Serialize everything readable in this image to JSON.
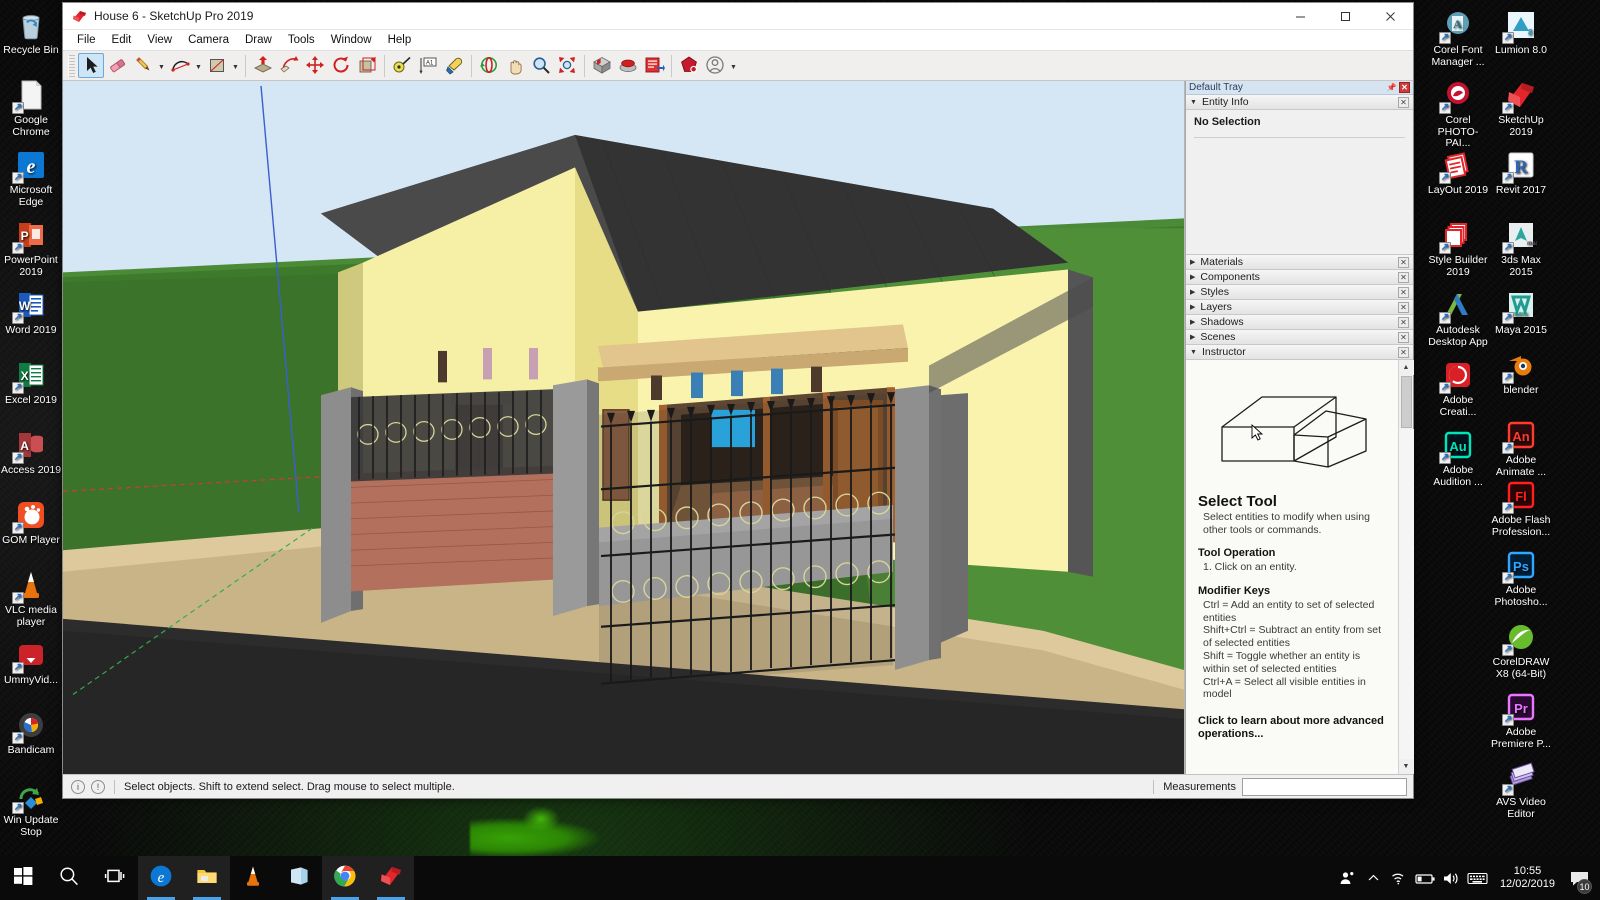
{
  "window": {
    "title": "House 6 - SketchUp Pro 2019",
    "app_icon": "sketchup-logo-icon",
    "controls": {
      "minimize": "—",
      "maximize": "☐",
      "close": "✕"
    }
  },
  "menu": [
    "File",
    "Edit",
    "View",
    "Camera",
    "Draw",
    "Tools",
    "Window",
    "Help"
  ],
  "toolbar": {
    "groups": [
      {
        "items": [
          {
            "name": "select-tool",
            "glyph": "arrow",
            "active": true
          },
          {
            "name": "eraser-tool",
            "glyph": "eraser",
            "active": false
          },
          {
            "name": "line-tool",
            "glyph": "pencil",
            "active": false,
            "dropdown": true
          },
          {
            "name": "arc-tool",
            "glyph": "arc",
            "active": false,
            "dropdown": true
          },
          {
            "name": "rectangle-tool",
            "glyph": "rectangle",
            "active": false,
            "dropdown": true
          }
        ]
      },
      {
        "items": [
          {
            "name": "push-pull-tool",
            "glyph": "pushpull",
            "active": false
          },
          {
            "name": "follow-me-tool",
            "glyph": "followme",
            "active": false
          },
          {
            "name": "move-tool",
            "glyph": "move",
            "active": false
          },
          {
            "name": "rotate-tool",
            "glyph": "rotate",
            "active": false
          },
          {
            "name": "scale-tool",
            "glyph": "scale",
            "active": false
          }
        ]
      },
      {
        "items": [
          {
            "name": "tape-measure-tool",
            "glyph": "tape",
            "active": false
          },
          {
            "name": "dimension-tool",
            "glyph": "dimension",
            "active": false
          },
          {
            "name": "paint-bucket-tool",
            "glyph": "paint",
            "active": false
          }
        ]
      },
      {
        "items": [
          {
            "name": "orbit-tool",
            "glyph": "orbit",
            "active": false
          },
          {
            "name": "pan-tool",
            "glyph": "pan",
            "active": false
          },
          {
            "name": "zoom-tool",
            "glyph": "zoom",
            "active": false
          },
          {
            "name": "zoom-extents-tool",
            "glyph": "zoomextents",
            "active": false
          }
        ]
      },
      {
        "items": [
          {
            "name": "warehouse-get-models",
            "glyph": "wh1",
            "active": false
          },
          {
            "name": "warehouse-share-model",
            "glyph": "wh2",
            "active": false
          },
          {
            "name": "warehouse-extension",
            "glyph": "wh3",
            "active": false
          }
        ]
      },
      {
        "items": [
          {
            "name": "extension-warehouse-button",
            "glyph": "ruby",
            "active": false
          },
          {
            "name": "account-button",
            "glyph": "account",
            "active": false,
            "dropdown": true
          }
        ]
      }
    ]
  },
  "tray": {
    "title": "Default Tray",
    "entity_info": {
      "header": "Entity Info",
      "selection": "No Selection"
    },
    "panels": [
      {
        "label": "Materials",
        "expanded": false
      },
      {
        "label": "Components",
        "expanded": false
      },
      {
        "label": "Styles",
        "expanded": false
      },
      {
        "label": "Layers",
        "expanded": false
      },
      {
        "label": "Shadows",
        "expanded": false
      },
      {
        "label": "Scenes",
        "expanded": false
      },
      {
        "label": "Instructor",
        "expanded": true
      }
    ],
    "instructor": {
      "tool_title": "Select Tool",
      "tool_desc": "Select entities to modify when using other tools or commands.",
      "operation_heading": "Tool Operation",
      "operation_step": "1. Click on an entity.",
      "modifier_heading": "Modifier Keys",
      "modifiers": [
        "Ctrl = Add an entity to set of selected entities",
        "Shift+Ctrl = Subtract an entity from set of selected entities",
        "Shift = Toggle whether an entity is within set of selected entities",
        "Ctrl+A = Select all visible entities in model"
      ],
      "learn_more": "Click to learn about more advanced operations..."
    }
  },
  "statusbar": {
    "message": "Select objects. Shift to extend select. Drag mouse to select multiple.",
    "measurements_label": "Measurements",
    "measurements_value": ""
  },
  "desktop": {
    "left_icons": [
      {
        "label": "Recycle Bin",
        "glyph": "recycle-bin-icon",
        "color": "#6ea8c8",
        "shortcut": false
      },
      {
        "label": "Google Chrome",
        "glyph": "document-icon",
        "color": "#e9e9e9",
        "shortcut": true
      },
      {
        "label": "Microsoft Edge",
        "glyph": "edge-icon",
        "color": "#0c78d4",
        "shortcut": true
      },
      {
        "label": "PowerPoint 2019",
        "glyph": "powerpoint-icon",
        "color": "#c43e1c",
        "shortcut": true
      },
      {
        "label": "Word 2019",
        "glyph": "word-icon",
        "color": "#185abd",
        "shortcut": true
      },
      {
        "label": "Excel 2019",
        "glyph": "excel-icon",
        "color": "#107c41",
        "shortcut": true
      },
      {
        "label": "Access 2019",
        "glyph": "access-icon",
        "color": "#a4373a",
        "shortcut": true
      },
      {
        "label": "GOM Player",
        "glyph": "gom-player-icon",
        "color": "#f04e23",
        "shortcut": true
      },
      {
        "label": "VLC media player",
        "glyph": "vlc-icon",
        "color": "#e8720c",
        "shortcut": true
      },
      {
        "label": "UmmyVid...",
        "glyph": "ummy-downloader-icon",
        "color": "#cc2229",
        "shortcut": true
      },
      {
        "label": "Bandicam",
        "glyph": "bandicam-icon",
        "color": "#3d3d3d",
        "shortcut": true
      },
      {
        "label": "Win Update Stop",
        "glyph": "win-update-stop-icon",
        "color": "#3da648",
        "shortcut": true
      }
    ],
    "right_icons_col1": [
      {
        "label": "Corel Font Manager ...",
        "glyph": "corel-font-manager-icon",
        "color": "#5e9fb5",
        "shortcut": true
      },
      {
        "label": "Corel PHOTO-PAI...",
        "glyph": "corel-photopaint-icon",
        "color": "#c41230",
        "shortcut": true
      },
      {
        "label": "LayOut 2019",
        "glyph": "layout-icon",
        "color": "#e3262b",
        "shortcut": true
      },
      {
        "label": "Style Builder 2019",
        "glyph": "style-builder-icon",
        "color": "#e3262b",
        "shortcut": true
      },
      {
        "label": "Autodesk Desktop App",
        "glyph": "autodesk-icon",
        "color": "#3ba33b",
        "shortcut": true
      },
      {
        "label": "Adobe Creati...",
        "glyph": "adobe-cc-icon",
        "color": "#da1f26",
        "shortcut": true
      },
      {
        "label": "Adobe Audition ...",
        "glyph": "adobe-audition-icon",
        "color": "#00e4bb",
        "shortcut": true
      }
    ],
    "right_icons_col2": [
      {
        "label": "Lumion 8.0",
        "glyph": "lumion-icon",
        "color": "#dff0f6",
        "shortcut": true
      },
      {
        "label": "SketchUp 2019",
        "glyph": "sketchup-icon",
        "color": "#e3262b",
        "shortcut": true
      },
      {
        "label": "Revit 2017",
        "glyph": "revit-icon",
        "color": "#2f66b3",
        "shortcut": true
      },
      {
        "label": "3ds Max 2015",
        "glyph": "3dsmax-icon",
        "color": "#2ba79e",
        "shortcut": true
      },
      {
        "label": "Maya 2015",
        "glyph": "maya-icon",
        "color": "#2eb5a8",
        "shortcut": true
      },
      {
        "label": "blender",
        "glyph": "blender-icon",
        "color": "#e87d0d",
        "shortcut": true
      },
      {
        "label": "Adobe Animate ...",
        "glyph": "adobe-animate-icon",
        "color": "#ff3b30",
        "shortcut": true
      },
      {
        "label": "Adobe Flash Profession...",
        "glyph": "adobe-flash-icon",
        "color": "#ff1f1f",
        "shortcut": true
      },
      {
        "label": "Adobe Photosho...",
        "glyph": "adobe-photoshop-icon",
        "color": "#31a8ff",
        "shortcut": true
      },
      {
        "label": "CorelDRAW X8 (64-Bit)",
        "glyph": "coreldraw-icon",
        "color": "#68bb2c",
        "shortcut": true
      },
      {
        "label": "Adobe Premiere P...",
        "glyph": "adobe-premiere-icon",
        "color": "#ea77ff",
        "shortcut": true
      },
      {
        "label": "AVS Video Editor",
        "glyph": "avs-video-editor-icon",
        "color": "#9e7fd4",
        "shortcut": true
      }
    ]
  },
  "taskbar": {
    "items": [
      {
        "name": "start-button",
        "glyph": "windows-logo-icon",
        "running": false
      },
      {
        "name": "search-button",
        "glyph": "search-icon",
        "running": false
      },
      {
        "name": "task-view-button",
        "glyph": "task-view-icon",
        "running": false
      },
      {
        "name": "taskbar-edge",
        "glyph": "edge-icon",
        "running": true
      },
      {
        "name": "taskbar-file-explorer",
        "glyph": "folder-icon",
        "running": true
      },
      {
        "name": "taskbar-vlc",
        "glyph": "vlc-icon",
        "running": false
      },
      {
        "name": "taskbar-store",
        "glyph": "store-icon",
        "running": false
      },
      {
        "name": "taskbar-chrome",
        "glyph": "chrome-icon",
        "running": true
      },
      {
        "name": "taskbar-sketchup",
        "glyph": "sketchup-icon",
        "running": true
      }
    ],
    "tray_icons": [
      "people-icon",
      "show-hidden-icons-chevron",
      "wifi-icon",
      "battery-icon",
      "volume-icon",
      "keyboard-icon"
    ],
    "clock": {
      "time": "10:55",
      "date": "12/02/2019"
    },
    "notifications": {
      "count": "10"
    }
  },
  "viewport": {
    "model_name": "house-model",
    "colors": {
      "sky": "#cfe3f5",
      "grass": "#3f7a2e",
      "grass_far": "#4c8a36",
      "ground": "#2d2d2d",
      "wall": "#f7f0a8",
      "roof": "#3a3a3a",
      "fence_brick": "#b3705c",
      "curb": "#dcc89a",
      "axis_blue": "#3a5fd0",
      "axis_red": "#d03a3a",
      "axis_green": "#2fae4a"
    }
  }
}
